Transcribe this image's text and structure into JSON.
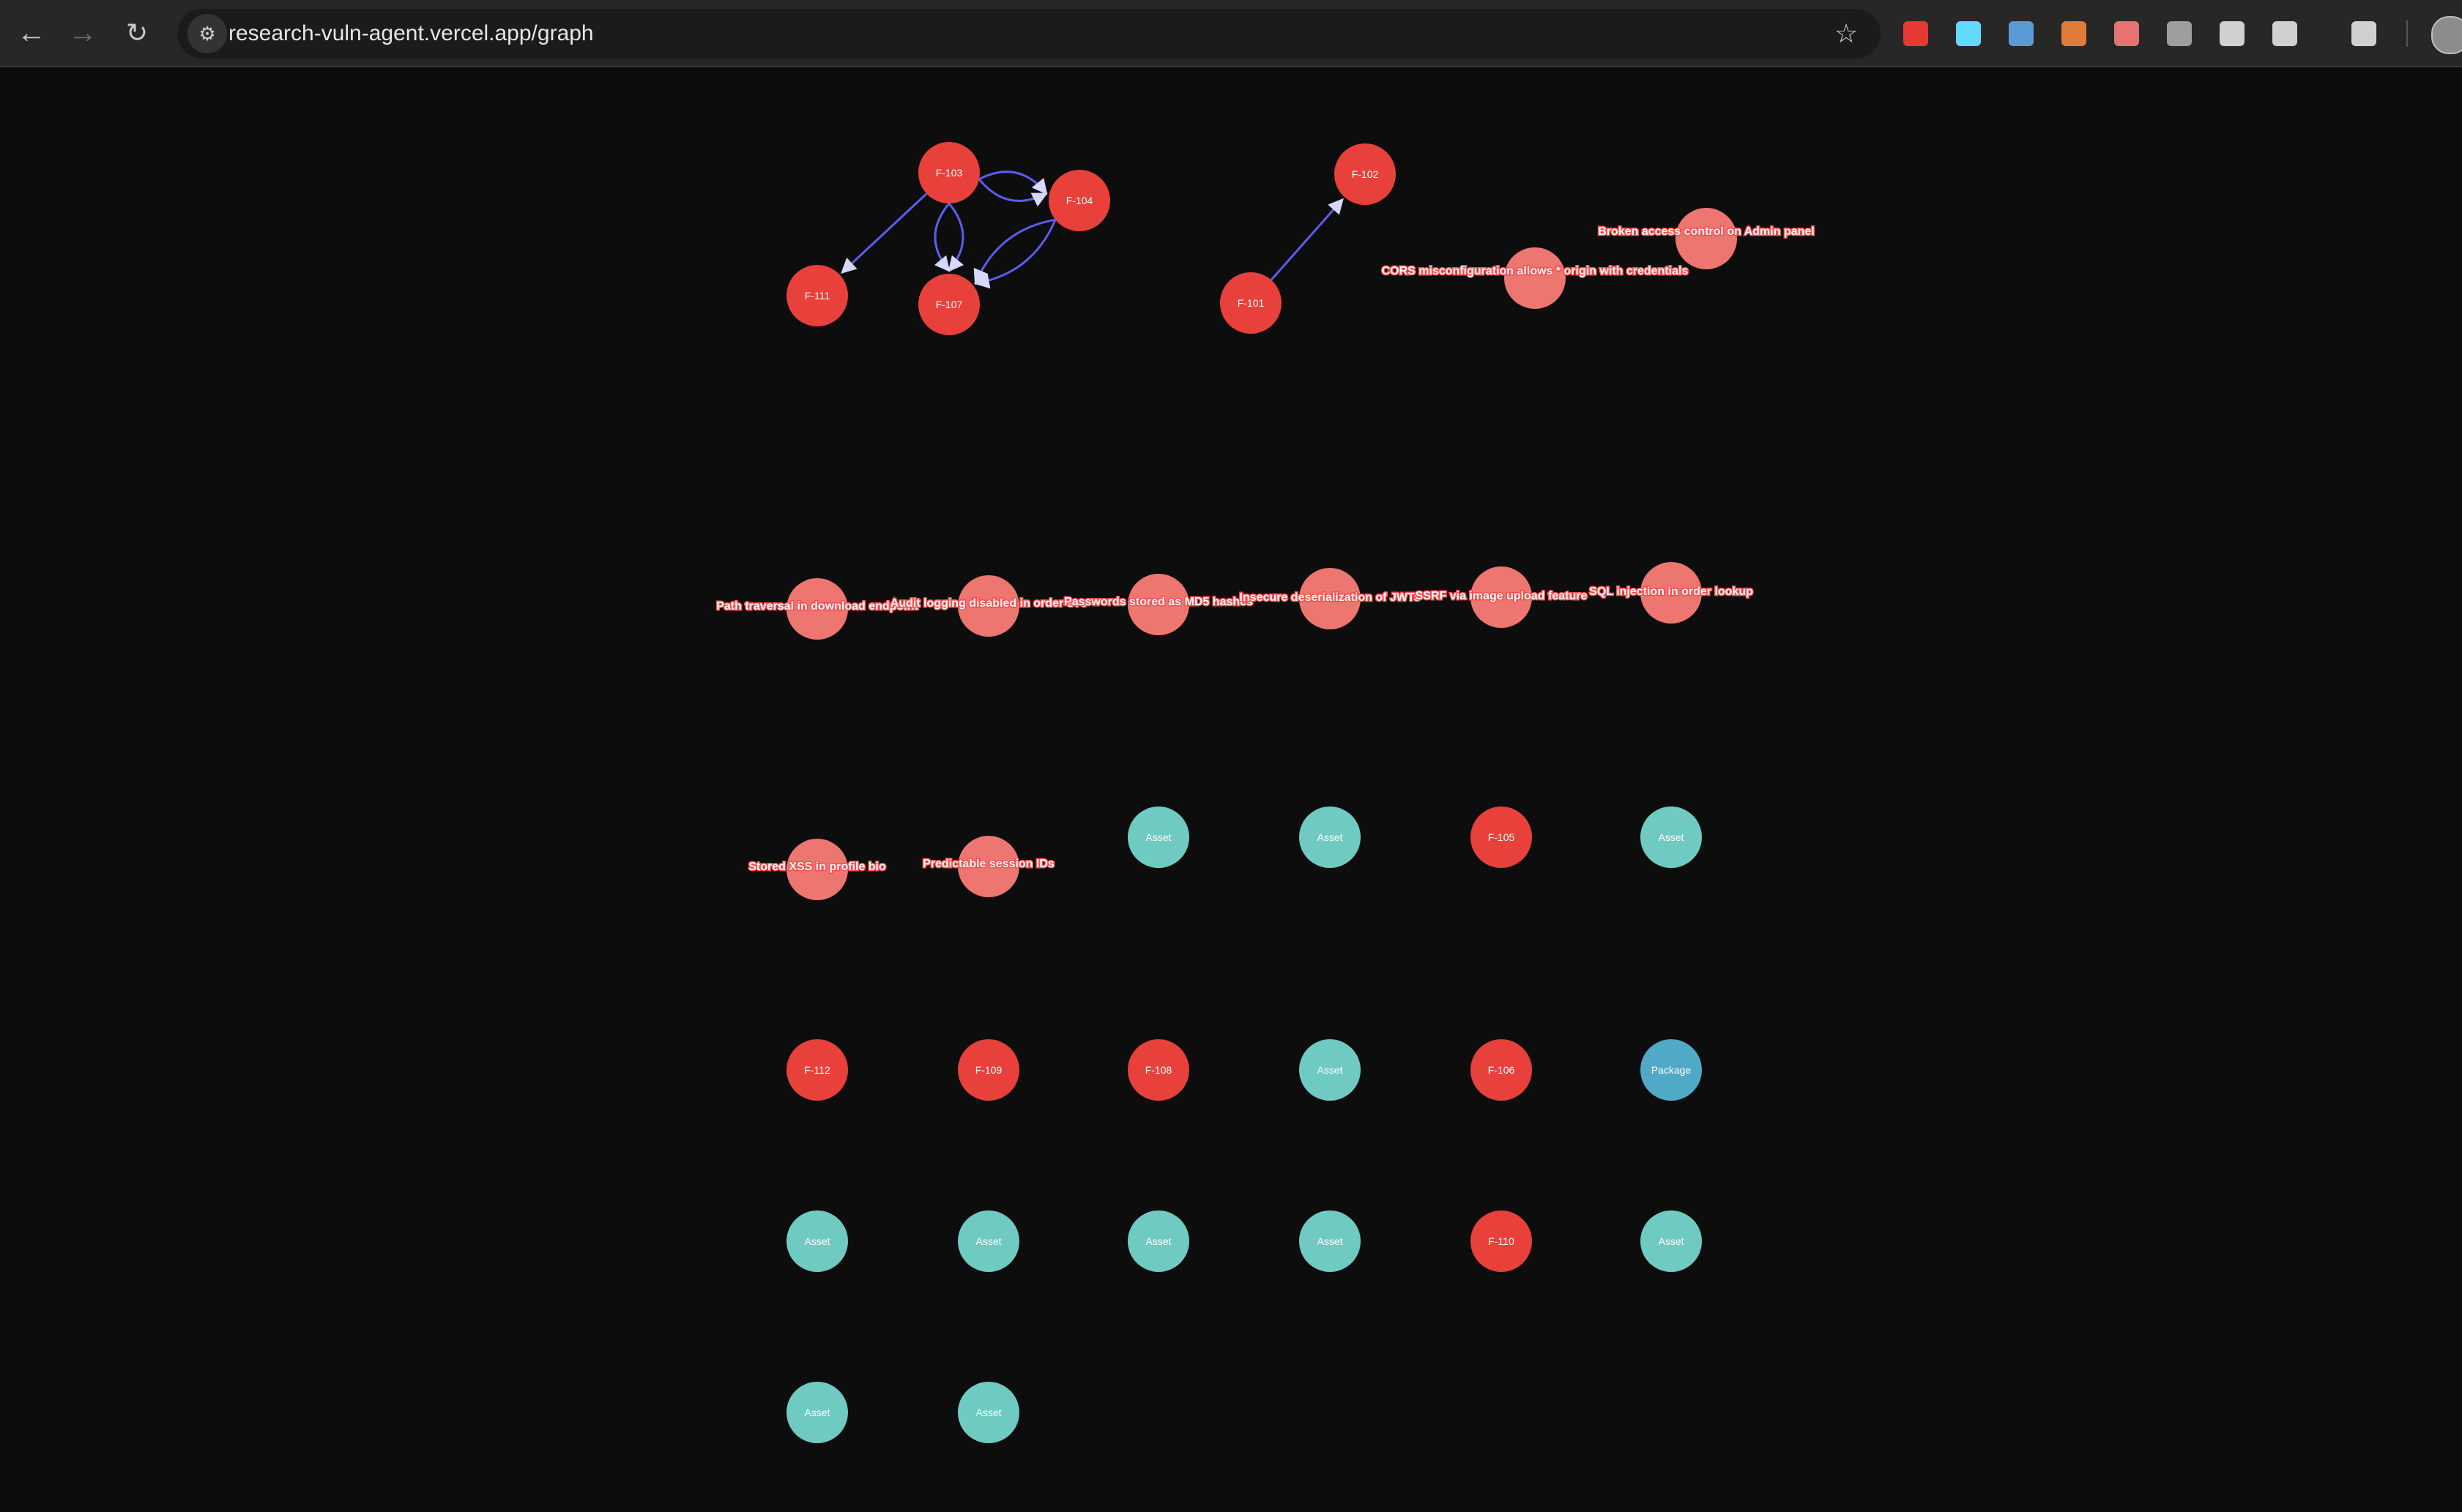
{
  "browser": {
    "url": "research-vuln-agent.vercel.app/graph",
    "back_icon": "arrow-left-icon",
    "forward_icon": "arrow-right-icon",
    "reload_icon": "reload-icon",
    "site_info_icon": "tune-icon",
    "bookmark_icon": "star-icon",
    "extensions": [
      {
        "name": "ext-hand-icon",
        "color": "#e53935"
      },
      {
        "name": "ext-react-icon",
        "color": "#61dafb"
      },
      {
        "name": "ext-screenshot-icon",
        "color": "#5b9bd5"
      },
      {
        "name": "ext-party-icon",
        "color": "#e07b39"
      },
      {
        "name": "ext-windows-icon",
        "color": "#e57373"
      },
      {
        "name": "ext-bolt-icon",
        "color": "#9e9e9e"
      },
      {
        "name": "ext-eyedropper-icon",
        "color": "#d0d0d0"
      },
      {
        "name": "ext-puzzle-icon",
        "color": "#d0d0d0"
      },
      {
        "name": "ext-tab-search-icon",
        "color": "#d0d0d0"
      }
    ]
  },
  "graph": {
    "colors": {
      "finding": "#e8403a",
      "finding_titled": "#ee7670",
      "asset": "#6fcbc1",
      "package": "#4fa9c7",
      "edge": "#5a5cf0"
    },
    "nodes": [
      {
        "id": "n103",
        "label": "F-103",
        "kind": "finding"
      },
      {
        "id": "n104",
        "label": "F-104",
        "kind": "finding"
      },
      {
        "id": "n111",
        "label": "F-111",
        "kind": "finding"
      },
      {
        "id": "n107",
        "label": "F-107",
        "kind": "finding"
      },
      {
        "id": "n102",
        "label": "F-102",
        "kind": "finding"
      },
      {
        "id": "n101",
        "label": "F-101",
        "kind": "finding"
      },
      {
        "id": "t_cors",
        "label": "CORS misconfiguration allows * origin with credentials",
        "kind": "finding_titled"
      },
      {
        "id": "t_bac",
        "label": "Broken access control on Admin panel",
        "kind": "finding_titled"
      },
      {
        "id": "t_path",
        "label": "Path traversal in download endpoint",
        "kind": "finding_titled"
      },
      {
        "id": "t_audit",
        "label": "Audit logging disabled in order-svc",
        "kind": "finding_titled"
      },
      {
        "id": "t_md5",
        "label": "Passwords stored as MD5 hashes",
        "kind": "finding_titled"
      },
      {
        "id": "t_jwt",
        "label": "Insecure deserialization of JWTs",
        "kind": "finding_titled"
      },
      {
        "id": "t_ssrf",
        "label": "SSRF via image upload feature",
        "kind": "finding_titled"
      },
      {
        "id": "t_sqli",
        "label": "SQL injection in order lookup",
        "kind": "finding_titled"
      },
      {
        "id": "t_xss",
        "label": "Stored XSS in profile bio",
        "kind": "finding_titled"
      },
      {
        "id": "t_sess",
        "label": "Predictable session IDs",
        "kind": "finding_titled"
      },
      {
        "id": "a1",
        "label": "Asset",
        "kind": "asset"
      },
      {
        "id": "a2",
        "label": "Asset",
        "kind": "asset"
      },
      {
        "id": "n105",
        "label": "F-105",
        "kind": "finding"
      },
      {
        "id": "a3",
        "label": "Asset",
        "kind": "asset"
      },
      {
        "id": "n112",
        "label": "F-112",
        "kind": "finding"
      },
      {
        "id": "n109",
        "label": "F-109",
        "kind": "finding"
      },
      {
        "id": "n108",
        "label": "F-108",
        "kind": "finding"
      },
      {
        "id": "a4",
        "label": "Asset",
        "kind": "asset"
      },
      {
        "id": "n106",
        "label": "F-106",
        "kind": "finding"
      },
      {
        "id": "p1",
        "label": "Package",
        "kind": "package"
      },
      {
        "id": "a5",
        "label": "Asset",
        "kind": "asset"
      },
      {
        "id": "a6",
        "label": "Asset",
        "kind": "asset"
      },
      {
        "id": "a7",
        "label": "Asset",
        "kind": "asset"
      },
      {
        "id": "a8",
        "label": "Asset",
        "kind": "asset"
      },
      {
        "id": "n110",
        "label": "F-110",
        "kind": "finding"
      },
      {
        "id": "a9",
        "label": "Asset",
        "kind": "asset"
      },
      {
        "id": "a10",
        "label": "Asset",
        "kind": "asset"
      },
      {
        "id": "a11",
        "label": "Asset",
        "kind": "asset"
      }
    ],
    "edges": [
      {
        "from": "n103",
        "to": "n104"
      },
      {
        "from": "n103",
        "to": "n104"
      },
      {
        "from": "n103",
        "to": "n111"
      },
      {
        "from": "n103",
        "to": "n107"
      },
      {
        "from": "n103",
        "to": "n107"
      },
      {
        "from": "n104",
        "to": "n107"
      },
      {
        "from": "n104",
        "to": "n107"
      },
      {
        "from": "n101",
        "to": "n102"
      }
    ]
  }
}
